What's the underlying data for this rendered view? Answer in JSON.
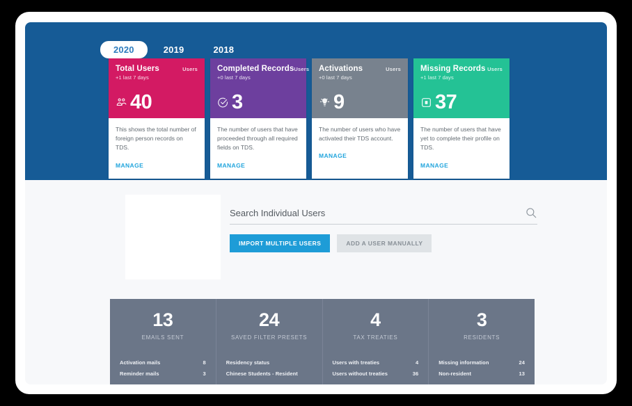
{
  "hero": {
    "year_tabs": [
      {
        "label": "2020",
        "active": true
      },
      {
        "label": "2019",
        "active": false
      },
      {
        "label": "2018",
        "active": false
      }
    ],
    "cards": [
      {
        "title": "Total Users",
        "badge": "Users",
        "sub": "+1 last 7 days",
        "value": "40",
        "icon": "people-group-icon",
        "description": "This shows the total number of foreign person records on TDS.",
        "manage_label": "MANAGE",
        "color": "#d31a63"
      },
      {
        "title": "Completed Records",
        "badge": "Users",
        "sub": "+0 last 7 days",
        "value": "3",
        "icon": "check-circle-icon",
        "description": "The number of users that have proceeded through all required fields on TDS.",
        "manage_label": "MANAGE",
        "color": "#6d3f9e"
      },
      {
        "title": "Activations",
        "badge": "Users",
        "sub": "+0 last 7 days",
        "value": "9",
        "icon": "lightbulb-icon",
        "description": "The number of users who have activated their TDS account.",
        "manage_label": "MANAGE",
        "color": "#78828e"
      },
      {
        "title": "Missing Records",
        "badge": "Users",
        "sub": "+1 last 7 days",
        "value": "37",
        "icon": "document-box-icon",
        "description": "The number of users that have yet to complete their profile on TDS.",
        "manage_label": "MANAGE",
        "color": "#24c295"
      }
    ]
  },
  "search": {
    "placeholder": "Search Individual Users",
    "value": "",
    "icon": "search-icon",
    "import_button_label": "IMPORT MULTIPLE USERS",
    "add_button_label": "ADD A USER MANUALLY"
  },
  "stats": {
    "columns": [
      {
        "number": "13",
        "label": "EMAILS SENT",
        "rows": [
          {
            "label": "Activation mails",
            "value": "8"
          },
          {
            "label": "Reminder mails",
            "value": "3"
          }
        ]
      },
      {
        "number": "24",
        "label": "SAVED FILTER PRESETS",
        "rows": [
          {
            "label": "Residency status",
            "value": ""
          },
          {
            "label": "Chinese Students - Resident",
            "value": ""
          }
        ]
      },
      {
        "number": "4",
        "label": "TAX TREATIES",
        "rows": [
          {
            "label": "Users with treaties",
            "value": "4"
          },
          {
            "label": "Users without treaties",
            "value": "36"
          }
        ]
      },
      {
        "number": "3",
        "label": "RESIDENTS",
        "rows": [
          {
            "label": "Missing information",
            "value": "24"
          },
          {
            "label": "Non-resident",
            "value": "13"
          }
        ]
      }
    ]
  },
  "colors": {
    "hero_blue": "#165b96",
    "accent_cyan": "#22a5dd",
    "primary_button": "#1e9cd7",
    "stats_panel": "#6b7688",
    "page_background": "#f7f8fa"
  }
}
